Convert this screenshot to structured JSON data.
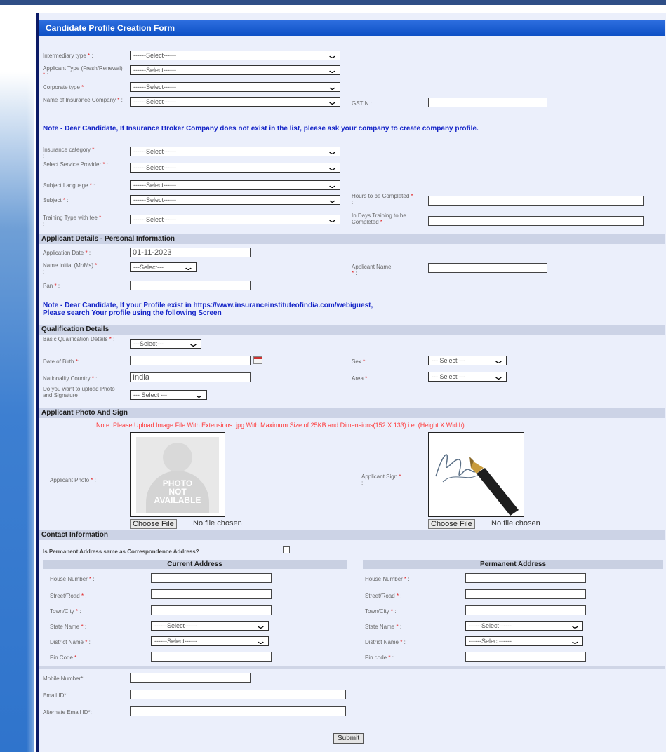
{
  "form_title": "Candidate Profile Creation Form",
  "select_placeholder": "------Select------",
  "select_short": "---Select---",
  "select_spaced": "--- Select ---",
  "required_mark": "*",
  "fields": {
    "intermediary_type": "Intermediary type",
    "applicant_type": "Applicant Type (Fresh/Renewal)",
    "corporate_type": "Corporate type",
    "insurance_company": "Name of Insurance Company",
    "gstin": "GSTIN :",
    "insurance_category": "Insurance category",
    "service_provider": "Select Service Provider",
    "subject_language": "Subject Language",
    "subject": "Subject",
    "hours": "Hours to be Completed",
    "training_type": "Training Type with fee",
    "days": "In Days Training to be Completed"
  },
  "note1": "Note - Dear Candidate, If Insurance Broker Company does not exist in the list, please ask your company to create company profile.",
  "section_personal": "Applicant Details - Personal Information",
  "personal": {
    "application_date_label": "Application Date",
    "application_date_value": "01-11-2023",
    "name_initial_label": "Name Initial (Mr/Ms)",
    "applicant_name_label": "Applicant Name",
    "pan_label": "Pan"
  },
  "note2_line1": "Note - Dear Candidate, If your Profile exist in https://www.insuranceinstituteofindia.com/webiguest,",
  "note2_line2": "Please search Your profile using the following  Screen",
  "section_qualification": "Qualification Details",
  "qualification": {
    "basic_label": "Basic Qualification Details",
    "dob_label": "Date of Birth",
    "sex_label": "Sex",
    "nationality_label": "Nationality Country",
    "nationality_value": "India",
    "area_label": "Area",
    "upload_label": "Do you want to upload Photo and Signature"
  },
  "section_photo": "Applicant Photo And Sign",
  "photo_note": "Note: Please Upload Image File With Extensions .jpg With Maximum Size of 25KB and Dimensions(152 X 133) i.e. (Height X Width)",
  "photo": {
    "photo_label": "Applicant Photo",
    "sign_label": "Applicant Sign",
    "placeholder_text": [
      "PHOTO",
      "NOT",
      "AVAILABLE"
    ],
    "choose_file": "Choose File",
    "no_file": "No file chosen"
  },
  "section_contact": "Contact Information",
  "contact": {
    "same_address_label": "Is Permanent Address same as Correspondence Address?",
    "current_header": "Current Address",
    "permanent_header": "Permanent Address",
    "house": "House Number",
    "street": "Street/Road",
    "town": "Town/City",
    "state": "State Name",
    "district": "District Name",
    "pin_current": "Pin Code",
    "pin_permanent": "Pin code",
    "mobile": "Mobile Number*:",
    "email": "Email ID*:",
    "alt_email": "Alternate Email ID*:"
  },
  "submit": "Submit",
  "colors": {
    "title_bar": "#1f5fd6",
    "frame_border": "#0b1a66",
    "form_bg": "#ebeffb",
    "section_bg": "#ccd3e6",
    "note": "#1424c7",
    "required": "#e02020"
  }
}
